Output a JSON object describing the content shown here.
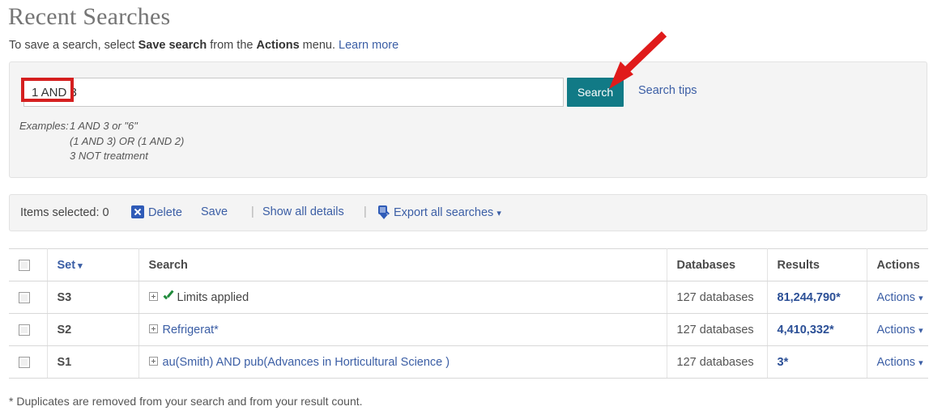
{
  "header": {
    "title": "Recent Searches",
    "subtitle_before": "To save a search, select ",
    "subtitle_bold1": "Save search",
    "subtitle_middle": " from the ",
    "subtitle_bold2": "Actions",
    "subtitle_after": " menu. ",
    "learn_more": "Learn more"
  },
  "search_panel": {
    "query_value": "1 AND 3",
    "query_placeholder": "",
    "search_button": "Search",
    "search_tips": "Search tips",
    "examples_label": "Examples:",
    "examples": [
      "1 AND 3 or \"6\"",
      "(1 AND 3) OR (1 AND 2)",
      "3 NOT treatment"
    ]
  },
  "toolbar": {
    "items_selected": "Items selected: 0",
    "delete": "Delete",
    "save": "Save",
    "separator": "|",
    "show_all_details": "Show all details",
    "export_all": "Export all searches",
    "caret": "▾"
  },
  "table": {
    "columns": {
      "checkbox": "",
      "set": "Set",
      "search": "Search",
      "databases": "Databases",
      "results": "Results",
      "actions": "Actions"
    },
    "sort_caret": "▾",
    "rows": [
      {
        "set": "S3",
        "search_text": "Limits applied",
        "search_is_link": false,
        "has_check": true,
        "databases": "127 databases",
        "results": "81,244,790*",
        "actions": "Actions"
      },
      {
        "set": "S2",
        "search_text": "Refrigerat*",
        "search_is_link": true,
        "has_check": false,
        "databases": "127 databases",
        "results": "4,410,332*",
        "actions": "Actions"
      },
      {
        "set": "S1",
        "search_text": "au(Smith) AND pub(Advances in Horticultural Science )",
        "search_is_link": true,
        "has_check": false,
        "databases": "127 databases",
        "results": "3*",
        "actions": "Actions"
      }
    ]
  },
  "footnote": "* Duplicates are removed from your search and from your result count.",
  "annotations": {
    "highlight_color": "#d51f1f",
    "arrow_color": "#e01b1b"
  },
  "colors": {
    "accent_teal": "#117a86",
    "link_blue": "#3b5ea5",
    "panel_gray": "#f4f4f4"
  }
}
